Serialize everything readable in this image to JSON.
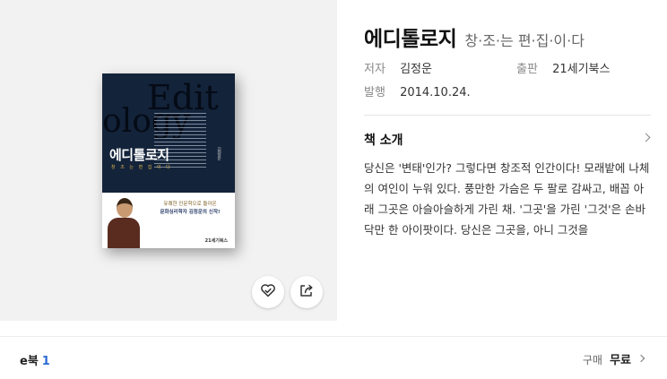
{
  "book": {
    "title": "에디톨로지",
    "subtitle": "창·조·는 편·집·이·다",
    "cover": {
      "deco_top": "Edit",
      "deco_bottom": "ology",
      "title": "에디톨로지",
      "subtitle": "창 조 는 편 집 이 다",
      "author_vertical": "김정운",
      "quote_line1": "유쾌한 인문학으로 돌아온",
      "quote_line2": "문화심리학자 김정운의 신작!",
      "publisher_mark": "21세기북스"
    }
  },
  "meta": {
    "author_label": "저자",
    "author_value": "김정운",
    "publisher_label": "출판",
    "publisher_value": "21세기북스",
    "date_label": "발행",
    "date_value": "2014.10.24."
  },
  "intro": {
    "heading": "책 소개",
    "text": "당신은 '변태'인가? 그렇다면 창조적 인간이다! 모래밭에 나체의 여인이 누워 있다. 풍만한 가슴은 두 팔로 감싸고, 배꼽 아래 그곳은 아슬아슬하게 가린 채. '그곳'을 가린 '그것'은 손바닥만 한 아이팟이다. 당신은 그곳을, 아니 그것을"
  },
  "footer": {
    "ebook_label": "e북",
    "ebook_count": "1",
    "buy_label": "구매",
    "buy_price": "무료"
  },
  "icons": {
    "like": "heart-check-icon",
    "share": "share-icon",
    "intro_more": "chevron-right-icon",
    "buy_more": "chevron-right-icon"
  }
}
